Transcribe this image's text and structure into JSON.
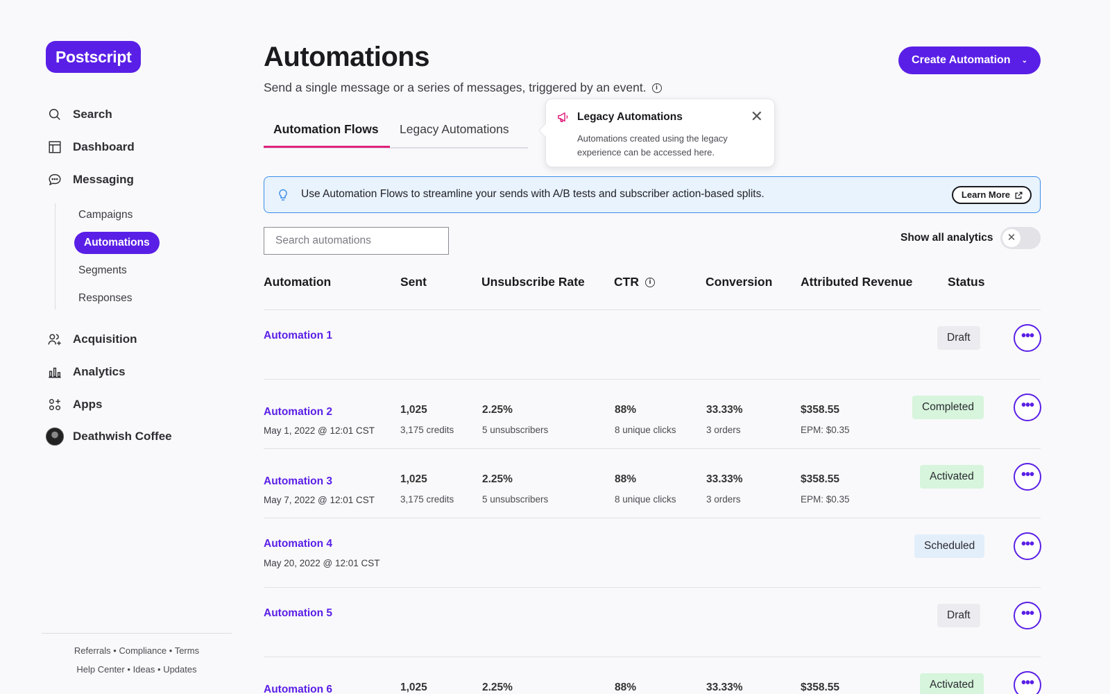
{
  "brand": {
    "logo": "Postscript",
    "accent": "#5a1fe6"
  },
  "sidebar": {
    "nav": [
      {
        "label": "Search",
        "icon": "search-icon"
      },
      {
        "label": "Dashboard",
        "icon": "dashboard-icon"
      },
      {
        "label": "Messaging",
        "icon": "chat-icon"
      }
    ],
    "messaging_sub": [
      "Campaigns",
      "Automations",
      "Segments",
      "Responses"
    ],
    "nav2": [
      {
        "label": "Acquisition",
        "icon": "users-plus-icon"
      },
      {
        "label": "Analytics",
        "icon": "bar-chart-icon"
      },
      {
        "label": "Apps",
        "icon": "apps-icon"
      },
      {
        "label": "Deathwish Coffee",
        "icon": "avatar"
      }
    ],
    "footer": {
      "referrals": "Referrals",
      "compliance": "Compliance",
      "terms": "Terms",
      "help": "Help Center",
      "ideas": "Ideas",
      "updates": "Updates",
      "sep": "•"
    }
  },
  "header": {
    "title": "Automations",
    "subtitle": "Send a single message or a series of messages, triggered by an event.",
    "create_button": "Create Automation"
  },
  "tabs": [
    {
      "label": "Automation Flows",
      "active": true
    },
    {
      "label": "Legacy Automations",
      "active": false
    }
  ],
  "popover": {
    "title": "Legacy Automations",
    "body": "Automations created using the legacy experience can be accessed here."
  },
  "banner": {
    "text": "Use Automation Flows to streamline your sends with A/B tests and subscriber action-based splits.",
    "button": "Learn More"
  },
  "search": {
    "placeholder": "Search automations"
  },
  "analytics_toggle": {
    "label": "Show all analytics",
    "on": false
  },
  "table": {
    "columns": [
      "Automation",
      "Sent",
      "Unsubscribe Rate",
      "CTR",
      "Conversion",
      "Attributed Revenue",
      "Status"
    ],
    "rows": [
      {
        "name": "Automation 1",
        "date": "",
        "sent": "",
        "sent_sub": "",
        "unsub": "",
        "unsub_sub": "",
        "ctr": "",
        "ctr_sub": "",
        "conv": "",
        "conv_sub": "",
        "rev": "",
        "rev_sub": "",
        "status": "Draft"
      },
      {
        "name": "Automation 2",
        "date": "May 1, 2022 @ 12:01 CST",
        "sent": "1,025",
        "sent_sub": "3,175 credits",
        "unsub": "2.25%",
        "unsub_sub": "5 unsubscribers",
        "ctr": "88%",
        "ctr_sub": "8 unique clicks",
        "conv": "33.33%",
        "conv_sub": "3 orders",
        "rev": "$358.55",
        "rev_sub": "EPM: $0.35",
        "status": "Completed"
      },
      {
        "name": "Automation 3",
        "date": "May 7, 2022 @ 12:01 CST",
        "sent": "1,025",
        "sent_sub": "3,175 credits",
        "unsub": "2.25%",
        "unsub_sub": "5 unsubscribers",
        "ctr": "88%",
        "ctr_sub": "8 unique clicks",
        "conv": "33.33%",
        "conv_sub": "3 orders",
        "rev": "$358.55",
        "rev_sub": "EPM: $0.35",
        "status": "Activated"
      },
      {
        "name": "Automation 4",
        "date": "May 20, 2022 @ 12:01 CST",
        "sent": "",
        "sent_sub": "",
        "unsub": "",
        "unsub_sub": "",
        "ctr": "",
        "ctr_sub": "",
        "conv": "",
        "conv_sub": "",
        "rev": "",
        "rev_sub": "",
        "status": "Scheduled"
      },
      {
        "name": "Automation 5",
        "date": "",
        "sent": "",
        "sent_sub": "",
        "unsub": "",
        "unsub_sub": "",
        "ctr": "",
        "ctr_sub": "",
        "conv": "",
        "conv_sub": "",
        "rev": "",
        "rev_sub": "",
        "status": "Draft"
      },
      {
        "name": "Automation 6",
        "date": "",
        "sent": "1,025",
        "sent_sub": "",
        "unsub": "2.25%",
        "unsub_sub": "",
        "ctr": "88%",
        "ctr_sub": "",
        "conv": "33.33%",
        "conv_sub": "",
        "rev": "$358.55",
        "rev_sub": "",
        "status": "Activated"
      }
    ],
    "more_label": "•••"
  },
  "status_colors": {
    "Draft": "#ececf0",
    "Completed": "#d6f5dc",
    "Activated": "#d6f5dc",
    "Scheduled": "#e3eefb"
  }
}
